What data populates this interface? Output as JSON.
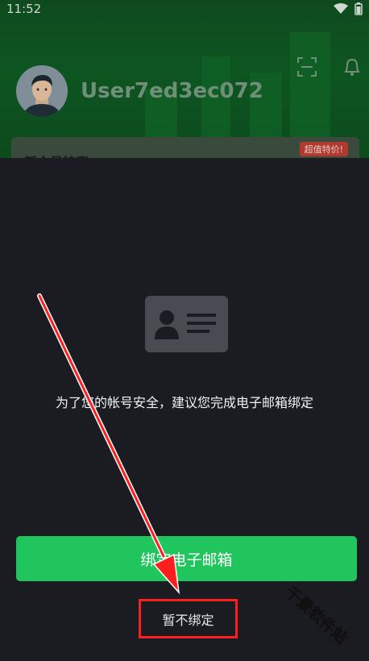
{
  "status_bar": {
    "time": "11:52"
  },
  "profile": {
    "username": "User7ed3ec072"
  },
  "promo": {
    "title": "新会员特惠",
    "badge": "超值特价!"
  },
  "dialog": {
    "message": "为了您的帐号安全，建议您完成电子邮箱绑定",
    "primary_label": "绑定电子邮箱",
    "skip_label": "暂不绑定"
  },
  "watermark": {
    "text": "千景软件站"
  },
  "colors": {
    "accent": "#21c55d",
    "sheet_bg": "#1b1c22",
    "highlight_red": "#ff1e1e"
  },
  "icons": [
    "wifi-icon",
    "battery-icon",
    "scan-icon",
    "bell-icon",
    "id-card-icon"
  ]
}
